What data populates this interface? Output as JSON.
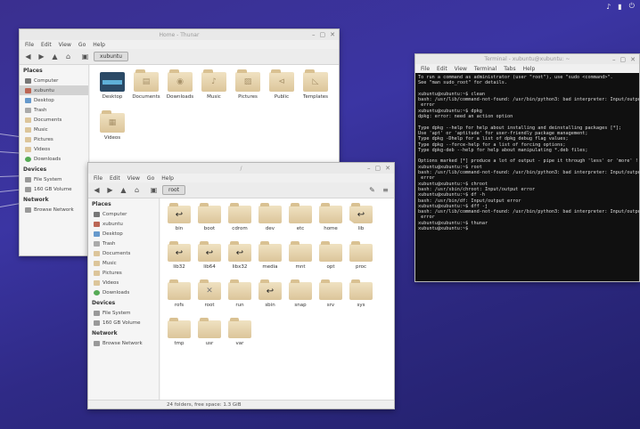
{
  "panel": {
    "icons": [
      "speaker-icon",
      "battery-icon",
      "power-icon"
    ]
  },
  "back_window": {
    "title": "Home - Thunar",
    "menu": [
      "File",
      "Edit",
      "View",
      "Go",
      "Help"
    ],
    "path": "xubuntu",
    "places_heading": "Places",
    "places": [
      "Computer",
      "xubuntu",
      "Desktop",
      "Trash",
      "Documents",
      "Music",
      "Pictures",
      "Videos",
      "Downloads"
    ],
    "devices_heading": "Devices",
    "devices": [
      "File System",
      "160 GB Volume"
    ],
    "network_heading": "Network",
    "network": [
      "Browse Network"
    ],
    "folders": [
      "Desktop",
      "Documents",
      "Downloads",
      "Music",
      "Pictures",
      "Public",
      "Templates",
      "Videos"
    ]
  },
  "front_window": {
    "title": "/",
    "menu": [
      "File",
      "Edit",
      "View",
      "Go",
      "Help"
    ],
    "path": "root",
    "places_heading": "Places",
    "places": [
      "Computer",
      "xubuntu",
      "Desktop",
      "Trash",
      "Documents",
      "Music",
      "Pictures",
      "Videos",
      "Downloads"
    ],
    "devices_heading": "Devices",
    "devices": [
      "File System",
      "160 GB Volume"
    ],
    "network_heading": "Network",
    "network": [
      "Browse Network"
    ],
    "folders": [
      "bin",
      "boot",
      "cdrom",
      "dev",
      "etc",
      "home",
      "lib",
      "lib32",
      "lib64",
      "libx32",
      "media",
      "mnt",
      "opt",
      "proc",
      "rofs",
      "root",
      "run",
      "sbin",
      "snap",
      "srv",
      "sys",
      "tmp",
      "usr",
      "var"
    ],
    "status": "24 folders, free space: 1.3 GiB"
  },
  "terminal": {
    "title": "Terminal - xubuntu@xubuntu: ~",
    "menu": [
      "File",
      "Edit",
      "View",
      "Terminal",
      "Tabs",
      "Help"
    ],
    "lines": [
      "To run a command as administrator (user \"root\"), use \"sudo <command>\".",
      "See \"man sudo_root\" for details.",
      "",
      "xubuntu@xubuntu:~$ clean",
      "bash: /usr/lib/command-not-found: /usr/bin/python3: bad interpreter: Input/output",
      " error",
      "xubuntu@xubuntu:~$ dpkg",
      "dpkg: error: need an action option",
      "",
      "Type dpkg --help for help about installing and deinstalling packages [*];",
      "Use 'apt' or 'aptitude' for user-friendly package management;",
      "Type dpkg -Dhelp for a list of dpkg debug flag values;",
      "Type dpkg --force-help for a list of forcing options;",
      "Type dpkg-deb --help for help about manipulating *.deb files;",
      "",
      "Options marked [*] produce a lot of output - pipe it through 'less' or 'more' !",
      "xubuntu@xubuntu:~$ root",
      "bash: /usr/lib/command-not-found: /usr/bin/python3: bad interpreter: Input/output",
      " error",
      "xubuntu@xubuntu:~$ chroot",
      "bash: /usr/sbin/chroot: Input/output error",
      "xubuntu@xubuntu:~$ df -h",
      "bash: /usr/bin/df: Input/output error",
      "xubuntu@xubuntu:~$ dff -j",
      "bash: /usr/lib/command-not-found: /usr/bin/python3: bad interpreter: Input/output",
      " error",
      "xubuntu@xubuntu:~$ thunar",
      "xubuntu@xubuntu:~$ "
    ]
  }
}
